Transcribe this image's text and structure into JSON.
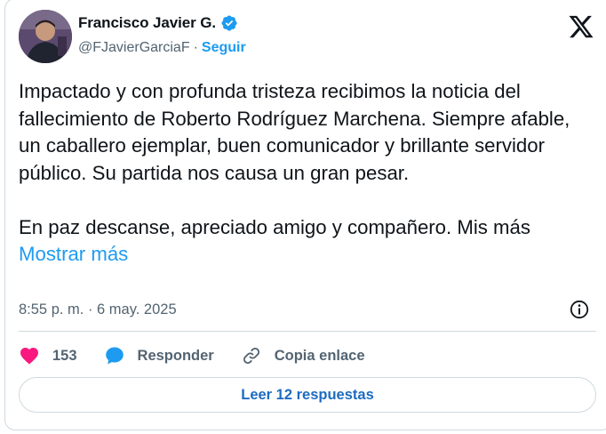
{
  "author": {
    "name": "Francisco Javier G.",
    "handle": "@FJavierGarciaF",
    "separator": "·",
    "follow_label": "Seguir"
  },
  "tweet": {
    "paragraph1": "Impactado y con profunda tristeza recibimos la noticia del fallecimiento de Roberto Rodríguez Marchena. Siempre afable, un caballero ejemplar, buen comunicador y brillante servidor público. Su partida nos causa un gran pesar.",
    "paragraph2": "En paz descanse, apreciado amigo y compañero. Mis más",
    "show_more": "Mostrar más",
    "timestamp": "8:55 p. m. · 6 may. 2025"
  },
  "actions": {
    "likes": "153",
    "reply_label": "Responder",
    "copy_link_label": "Copia enlace"
  },
  "read_replies_label": "Leer 12 respuestas",
  "colors": {
    "accent": "#1d9bf0",
    "like": "#f91880",
    "text_secondary": "#536471",
    "border": "#cfd9de"
  },
  "icons": [
    "avatar",
    "verified-badge-icon",
    "x-logo-icon",
    "info-icon",
    "heart-icon",
    "reply-bubble-icon",
    "link-icon"
  ]
}
